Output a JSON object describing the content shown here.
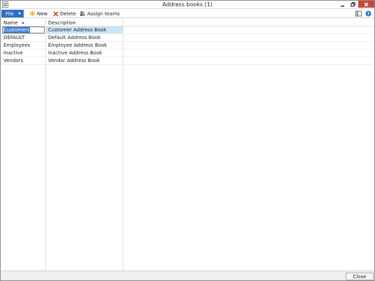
{
  "window": {
    "title": "Address books (1)"
  },
  "toolbar": {
    "file_label": "File",
    "new_label": "New",
    "delete_label": "Delete",
    "assign_teams_label": "Assign teams"
  },
  "grid": {
    "columns": [
      "Name",
      "Description"
    ],
    "rows": [
      {
        "name": "Customers",
        "description": "Customer Address Book",
        "selected": true
      },
      {
        "name": "DEFAULT",
        "description": "Default Address Book"
      },
      {
        "name": "Employees",
        "description": "Employee Address Book"
      },
      {
        "name": "Inactive",
        "description": "Inactive Address Book"
      },
      {
        "name": "Vendors",
        "description": "Vendor Address Book"
      }
    ]
  },
  "footer": {
    "close_label": "Close"
  },
  "colors": {
    "file_button": "#2b6fc4",
    "close_button": "#c7483a",
    "selected_row": "#cce5f7"
  }
}
